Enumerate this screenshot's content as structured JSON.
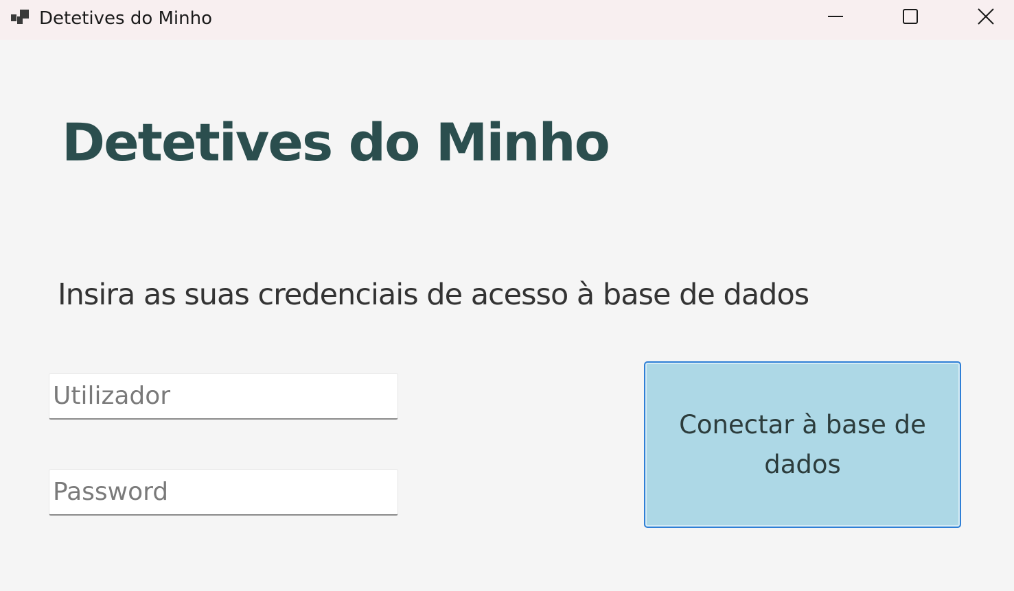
{
  "window": {
    "title": "Detetives do Minho",
    "icon": "app-window-icon",
    "controls": [
      "minimize-icon",
      "maximize-icon",
      "close-icon"
    ]
  },
  "form": {
    "heading": "Detetives do Minho",
    "subheading": "Insira as suas credenciais de acesso à base de dados",
    "username": {
      "placeholder": "Utilizador",
      "value": ""
    },
    "password": {
      "placeholder": "Password",
      "value": ""
    },
    "connect_label": "Conectar à base de dados"
  },
  "colors": {
    "heading": "#2b4e4e",
    "button_bg": "#add8e6",
    "button_border": "#2f7fd6",
    "titlebar": "#f8eff0",
    "background": "#f5f5f5"
  }
}
